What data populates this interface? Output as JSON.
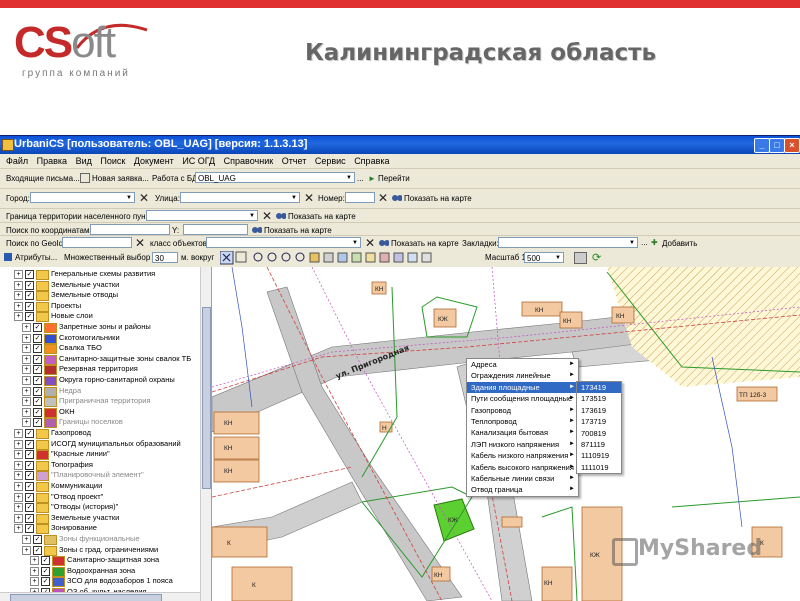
{
  "slide": {
    "logo_main": "CS",
    "logo_soft": "oft",
    "logo_sub": "группа компаний",
    "title": "Калининградская область",
    "watermark": "MyShared"
  },
  "window": {
    "title": "UrbaniCS [пользователь: OBL_UAG] [версия: 1.1.3.13]",
    "menu": [
      "Файл",
      "Правка",
      "Вид",
      "Поиск",
      "Документ",
      "ИС ОГД",
      "Справочник",
      "Отчет",
      "Сервис",
      "Справка"
    ]
  },
  "rows": {
    "r1": {
      "incoming": "Входящие письма...",
      "new_request": "Новая заявка...",
      "db_label": "Работа с БД:",
      "db_value": "OBL_UAG",
      "go": "Перейти"
    },
    "r2": {
      "city_label": "Город:",
      "street_label": "Улица:",
      "number_label": "Номер:",
      "show_map": "Показать на карте"
    },
    "r3": {
      "border_label": "Граница территории населенного пункта:",
      "show_map": "Показать на карте"
    },
    "r4": {
      "coord_x_label": "Поиск по координатам X:",
      "coord_y_label": "Y:",
      "show_map": "Показать на карте"
    },
    "r5": {
      "geoid_label": "Поиск по GeoId:",
      "class_label": "класс объектов:",
      "show_map": "Показать на карте",
      "bookmarks_label": "Закладки:",
      "add": "Добавить"
    }
  },
  "toolbar": {
    "attributes": "Атрибуты...",
    "multi_select": "Множественный выбор на",
    "multi_value": "30",
    "around": "м. вокруг",
    "scale_label": "Масштаб 1:",
    "scale_value": "500"
  },
  "tree": [
    "Генеральные схемы развития",
    "Земельные участки",
    "Земельные отводы",
    "Проекты",
    "Новые слои",
    "Запретные зоны и районы",
    "Скотомогильники",
    "Свалка ТБО",
    "Санитарно-защитные зоны свалок ТБ",
    "Резервная территория",
    "Округа горно-санитарной охраны",
    "Недра",
    "Приграничная территория",
    "ОКН",
    "Границы поселков",
    "Газопровод",
    "ИСОГД муниципальных образований",
    "\"Красные линии\"",
    "Топография",
    "\"Планировочный элемент\"",
    "Коммуникации",
    "\"Отвод проект\"",
    "\"Отводы (история)\"",
    "Земельные участки",
    "Зонирование",
    "Зоны функциональные",
    "Зоны с град. ограничениями",
    "Санитарно-защитная зона",
    "Водоохранная зона",
    "ЗСО для водозаборов 1 пояса",
    "ОЗ об. культ. наследия"
  ],
  "context_menu": [
    "Адреса",
    "Ограждения линейные",
    "Здания площадные",
    "Пути сообщения площадные",
    "Газопровод",
    "Теплопровод",
    "Канализация бытовая",
    "ЛЭП низкого напряжения",
    "Кабель низкого напряжения",
    "Кабель высокого напряжения",
    "Кабельные линии связи",
    "Отвод граница"
  ],
  "submenu": [
    "173419",
    "173519",
    "173619",
    "173719",
    "700819",
    "871119",
    "1110919",
    "1111019"
  ],
  "map": {
    "street": "ул. Пригородная",
    "labels": [
      "КЖ",
      "КН",
      "Н",
      "КН",
      "КН",
      "КН",
      "ТП 12б-3",
      "КН",
      "КН",
      "КН",
      "КЖ",
      "К",
      "К",
      "КЖ",
      "КН",
      "К",
      "КН"
    ],
    "scale_text": "40м"
  }
}
